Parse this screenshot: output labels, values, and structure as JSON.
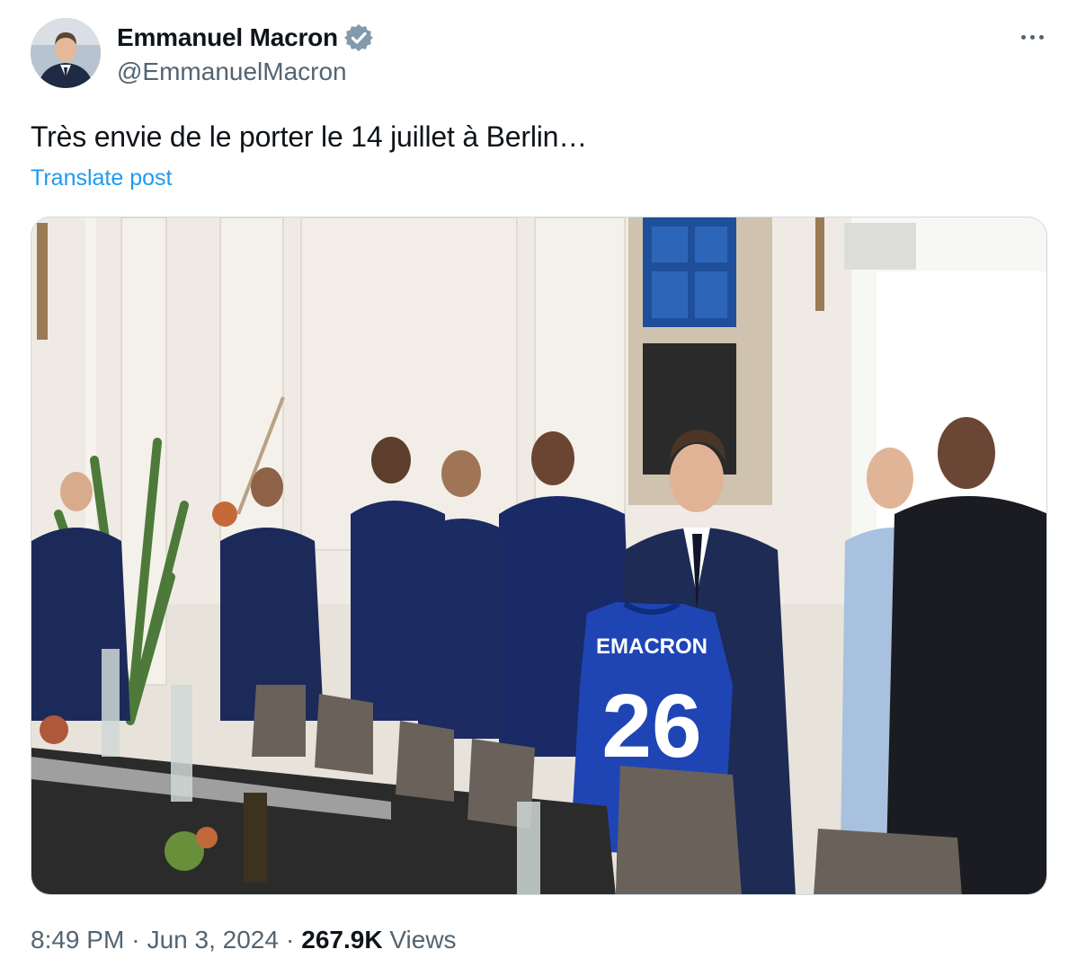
{
  "author": {
    "display_name": "Emmanuel Macron",
    "handle": "@EmmanuelMacron",
    "verified": true,
    "avatar_icon": "profile-photo"
  },
  "post": {
    "text": "Très envie de le porter le 14 juillet à Berlin…",
    "translate_label": "Translate post"
  },
  "media": {
    "jersey_name": "EMACRON",
    "jersey_number": "26"
  },
  "meta": {
    "time": "8:49 PM",
    "separator": "·",
    "date": "Jun 3, 2024",
    "views_count": "267.9K",
    "views_label": "Views"
  },
  "colors": {
    "link": "#1d9bf0",
    "verified": "#829aab",
    "secondary_text": "#536471"
  }
}
